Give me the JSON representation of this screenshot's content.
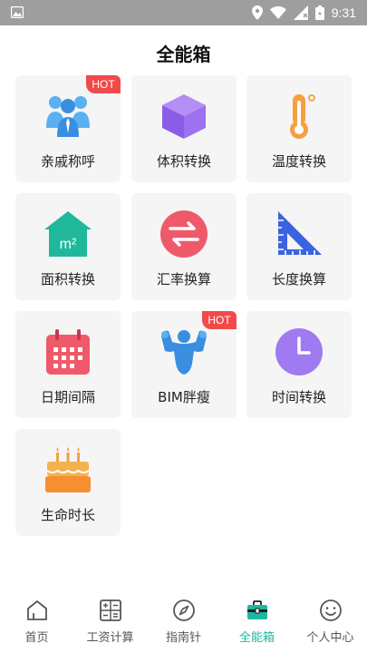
{
  "status": {
    "time": "9:31"
  },
  "page": {
    "title": "全能箱"
  },
  "tools": [
    {
      "label": "亲戚称呼",
      "icon": "family-icon",
      "hot": "HOT"
    },
    {
      "label": "体积转换",
      "icon": "cube-icon",
      "hot": ""
    },
    {
      "label": "温度转换",
      "icon": "thermometer-icon",
      "hot": ""
    },
    {
      "label": "面积转换",
      "icon": "house-area-icon",
      "hot": ""
    },
    {
      "label": "汇率换算",
      "icon": "exchange-icon",
      "hot": ""
    },
    {
      "label": "长度换算",
      "icon": "ruler-icon",
      "hot": ""
    },
    {
      "label": "日期间隔",
      "icon": "calendar-icon",
      "hot": ""
    },
    {
      "label": "BIM胖瘦",
      "icon": "muscle-icon",
      "hot": "HOT"
    },
    {
      "label": "时间转换",
      "icon": "clock-icon",
      "hot": ""
    },
    {
      "label": "生命时长",
      "icon": "cake-icon",
      "hot": ""
    }
  ],
  "tabs": [
    {
      "label": "首页",
      "icon": "home-icon",
      "active": false
    },
    {
      "label": "工资计算",
      "icon": "calculator-icon",
      "active": false
    },
    {
      "label": "指南针",
      "icon": "compass-icon",
      "active": false
    },
    {
      "label": "全能箱",
      "icon": "toolbox-icon",
      "active": true
    },
    {
      "label": "个人中心",
      "icon": "smiley-icon",
      "active": false
    }
  ],
  "colors": {
    "accent": "#1fb7a3",
    "hot": "#f04a4a",
    "card_bg": "#f5f5f5"
  }
}
